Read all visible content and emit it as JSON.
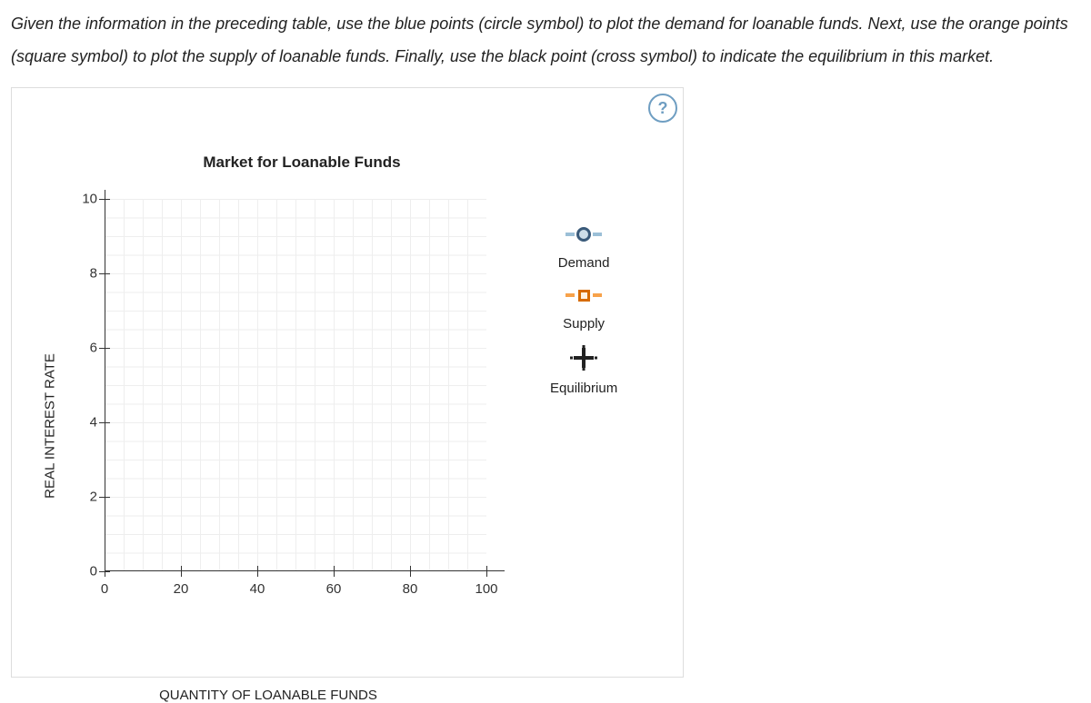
{
  "instructions": "Given the information in the preceding table, use the blue points (circle symbol) to plot the demand for loanable funds. Next, use the orange points (square symbol) to plot the supply of loanable funds. Finally, use the black point (cross symbol) to indicate the equilibrium in this market.",
  "help_label": "?",
  "chart_data": {
    "type": "scatter",
    "title": "Market for Loanable Funds",
    "xlabel": "QUANTITY OF LOANABLE FUNDS",
    "ylabel": "REAL INTEREST RATE",
    "xlim": [
      0,
      100
    ],
    "ylim": [
      0,
      10
    ],
    "x_ticks": [
      0,
      20,
      40,
      60,
      80,
      100
    ],
    "y_ticks": [
      0,
      2,
      4,
      6,
      8,
      10
    ],
    "series": [
      {
        "name": "Demand",
        "symbol": "circle",
        "color": "#3a5a7a",
        "values": []
      },
      {
        "name": "Supply",
        "symbol": "square",
        "color": "#d66b00",
        "values": []
      },
      {
        "name": "Equilibrium",
        "symbol": "cross",
        "color": "#222",
        "values": []
      }
    ]
  },
  "legend": {
    "demand": "Demand",
    "supply": "Supply",
    "equilibrium": "Equilibrium"
  }
}
